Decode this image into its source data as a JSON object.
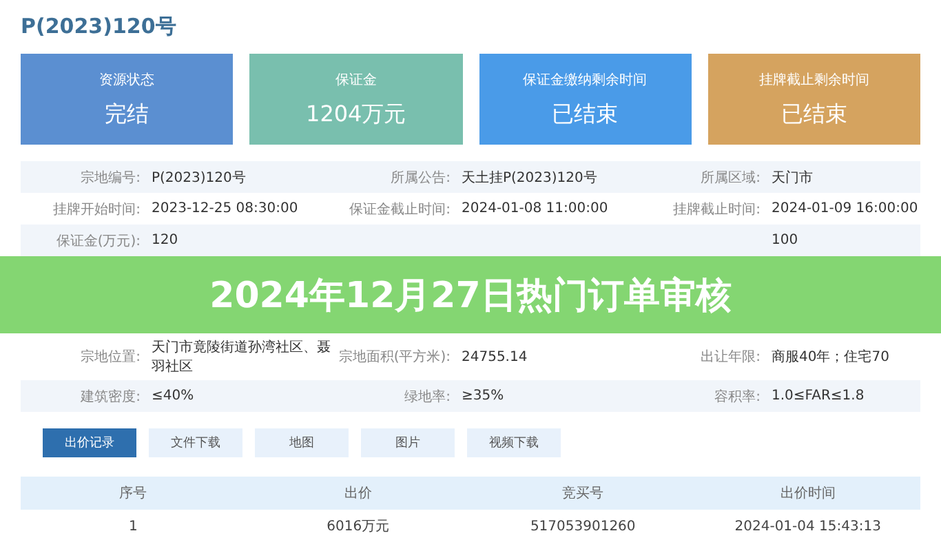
{
  "title": "P(2023)120号",
  "cards": [
    {
      "label": "资源状态",
      "value": "完结",
      "color": "#5b8fd1"
    },
    {
      "label": "保证金",
      "value": "1204万元",
      "color": "#79bfae"
    },
    {
      "label": "保证金缴纳剩余时间",
      "value": "已结束",
      "color": "#4a9be8"
    },
    {
      "label": "挂牌截止剩余时间",
      "value": "已结束",
      "color": "#d5a35f"
    }
  ],
  "info_upper": [
    [
      {
        "label": "宗地编号:",
        "value": "P(2023)120号"
      },
      {
        "label": "所属公告:",
        "value": "天土挂P(2023)120号"
      },
      {
        "label": "所属区域:",
        "value": "天门市"
      }
    ],
    [
      {
        "label": "挂牌开始时间:",
        "value": "2023-12-25 08:30:00"
      },
      {
        "label": "保证金截止时间:",
        "value": "2024-01-08 11:00:00"
      },
      {
        "label": "挂牌截止时间:",
        "value": "2024-01-09 16:00:00"
      }
    ],
    {
      "left": {
        "label": "保证金(万元):",
        "value": "120"
      },
      "right": {
        "value": "100"
      }
    }
  ],
  "banner": "2024年12月27日热门订单审核",
  "info_lower": [
    [
      {
        "label": "宗地位置:",
        "value": "天门市竟陵街道孙湾社区、聂羽社区"
      },
      {
        "label": "宗地面积(平方米):",
        "value": "24755.14"
      },
      {
        "label": "出让年限:",
        "value": "商服40年；住宅70"
      }
    ],
    [
      {
        "label": "建筑密度:",
        "value": "≤40%"
      },
      {
        "label": "绿地率:",
        "value": "≥35%"
      },
      {
        "label": "容积率:",
        "value": "1.0≤FAR≤1.8"
      }
    ]
  ],
  "tabs": [
    {
      "label": "出价记录",
      "selected": true
    },
    {
      "label": "文件下载",
      "selected": false
    },
    {
      "label": "地图",
      "selected": false
    },
    {
      "label": "图片",
      "selected": false
    },
    {
      "label": "视频下载",
      "selected": false
    }
  ],
  "table": {
    "columns": [
      "序号",
      "出价",
      "竞买号",
      "出价时间"
    ],
    "rows": [
      [
        "1",
        "6016万元",
        "517053901260",
        "2024-01-04 15:43:13"
      ]
    ]
  }
}
